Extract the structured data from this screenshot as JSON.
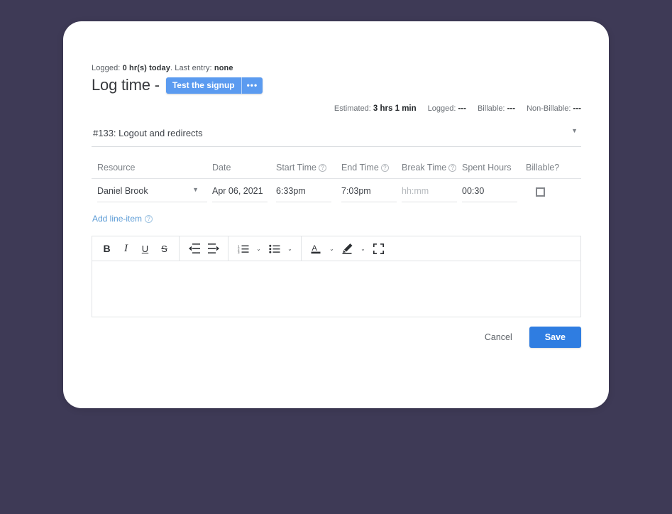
{
  "header": {
    "logged_prefix": "Logged:",
    "logged_value": "0 hr(s) today",
    "logged_sep": ". Last entry:",
    "last_entry_value": "none",
    "title": "Log time -",
    "task_badge_label": "Test the signup",
    "task_badge_more": "•••"
  },
  "stats": [
    {
      "label": "Estimated:",
      "value": "3 hrs 1 min"
    },
    {
      "label": "Logged:",
      "value": "---"
    },
    {
      "label": "Billable:",
      "value": "---"
    },
    {
      "label": "Non-Billable:",
      "value": "---"
    }
  ],
  "task_select": {
    "value": "#133: Logout and redirects",
    "caret": "▼"
  },
  "table": {
    "headers": {
      "resource": "Resource",
      "date": "Date",
      "start_time": "Start Time",
      "end_time": "End Time",
      "break_time": "Break Time",
      "spent_hours": "Spent Hours",
      "billable": "Billable?"
    },
    "help_glyph": "?",
    "row": {
      "resource": "Daniel Brook",
      "resource_caret": "▼",
      "date": "Apr 06, 2021",
      "start_time": "6:33pm",
      "end_time": "7:03pm",
      "break_time_placeholder": "hh:mm",
      "spent_hours": "00:30",
      "billable_checked": false
    }
  },
  "add_line_item": {
    "label": "Add line-item",
    "help_glyph": "?"
  },
  "editor": {
    "toolbar": [
      {
        "name": "bold",
        "glyph": "B"
      },
      {
        "name": "italic",
        "glyph": "I"
      },
      {
        "name": "underline",
        "glyph": "U"
      },
      {
        "name": "strikethrough",
        "glyph": "S"
      },
      {
        "name": "outdent",
        "glyph": "⇤"
      },
      {
        "name": "indent",
        "glyph": "⇥"
      },
      {
        "name": "ordered-list",
        "glyph": "☰"
      },
      {
        "name": "ordered-list-caret",
        "glyph": "⌄"
      },
      {
        "name": "bullet-list",
        "glyph": "☰"
      },
      {
        "name": "bullet-list-caret",
        "glyph": "⌄"
      },
      {
        "name": "text-color",
        "glyph": "A"
      },
      {
        "name": "text-color-caret",
        "glyph": "⌄"
      },
      {
        "name": "highlight-color",
        "glyph": "✏"
      },
      {
        "name": "highlight-color-caret",
        "glyph": "⌄"
      },
      {
        "name": "fullscreen",
        "glyph": "⛶"
      }
    ],
    "content": ""
  },
  "footer": {
    "cancel_label": "Cancel",
    "save_label": "Save"
  },
  "colors": {
    "page_background": "#3e3a56",
    "card_background": "#ffffff",
    "badge_blue": "#5b9bf0",
    "save_blue": "#2f7de1",
    "link_blue": "#5b9bd6"
  }
}
